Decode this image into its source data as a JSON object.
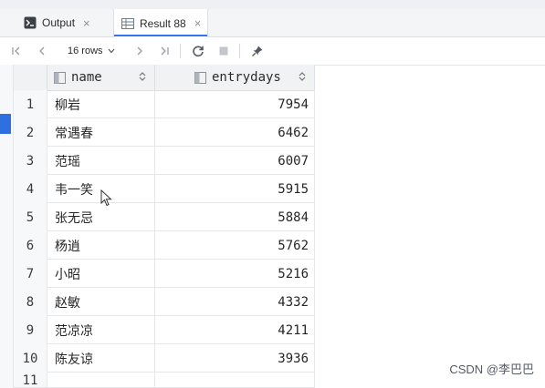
{
  "tabs": [
    {
      "label": "Output",
      "close": "×",
      "icon": "console-icon"
    },
    {
      "label": "Result 88",
      "close": "×",
      "icon": "table-icon",
      "active": true
    }
  ],
  "toolbar": {
    "first": "|<",
    "prev": "<",
    "rows_label": "16 rows",
    "next": ">",
    "last": ">|",
    "icons": [
      "first-page-icon",
      "prev-page-icon",
      "next-page-icon",
      "last-page-icon",
      "refresh-icon",
      "stop-icon",
      "pin-icon"
    ]
  },
  "columns": [
    "name",
    "entrydays"
  ],
  "rows": [
    {
      "num": "1",
      "name": "柳岩",
      "entrydays": "7954"
    },
    {
      "num": "2",
      "name": "常遇春",
      "entrydays": "6462"
    },
    {
      "num": "3",
      "name": "范瑶",
      "entrydays": "6007"
    },
    {
      "num": "4",
      "name": "韦一笑",
      "entrydays": "5915"
    },
    {
      "num": "5",
      "name": "张无忌",
      "entrydays": "5884"
    },
    {
      "num": "6",
      "name": "杨逍",
      "entrydays": "5762"
    },
    {
      "num": "7",
      "name": "小昭",
      "entrydays": "5216"
    },
    {
      "num": "8",
      "name": "赵敏",
      "entrydays": "4332"
    },
    {
      "num": "9",
      "name": "范凉凉",
      "entrydays": "4211"
    },
    {
      "num": "10",
      "name": "陈友谅",
      "entrydays": "3936"
    },
    {
      "num": "11",
      "name": "",
      "entrydays": ""
    }
  ],
  "watermark": "CSDN @李巴巴",
  "colors": {
    "accent": "#3574f0",
    "marker": "#2f6fe0"
  }
}
